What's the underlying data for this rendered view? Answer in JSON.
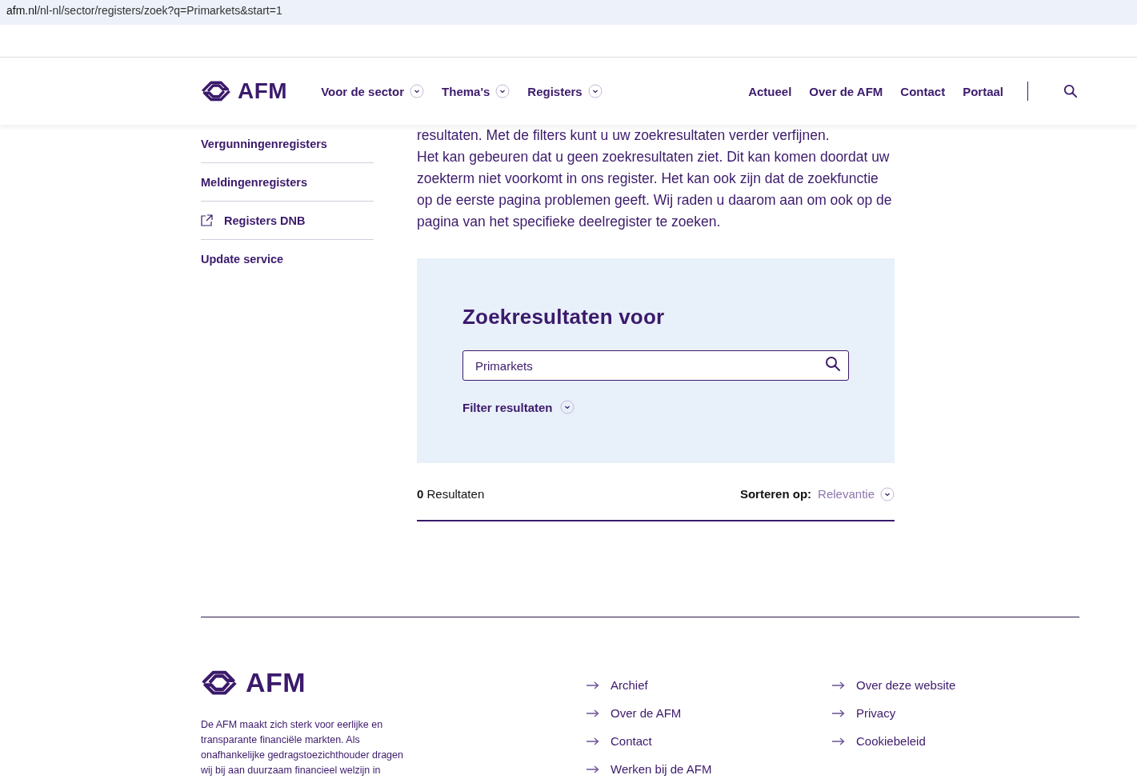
{
  "address_bar": {
    "domain": "afm.nl",
    "path": "/nl-nl/sector/registers/zoek?q=Primarkets&start=1"
  },
  "header": {
    "logo_text": "AFM",
    "nav_menus": [
      {
        "label": "Voor de sector",
        "expanded": false
      },
      {
        "label": "Thema's",
        "expanded": false
      },
      {
        "label": "Registers",
        "expanded": false
      }
    ],
    "nav_links": [
      "Actueel",
      "Over de AFM",
      "Contact",
      "Portaal"
    ]
  },
  "sidebar": {
    "items": [
      {
        "label": "Vergunningenregisters",
        "kind": "link"
      },
      {
        "label": "Meldingenregisters",
        "kind": "link"
      },
      {
        "label": "Registers DNB",
        "kind": "external"
      },
      {
        "label": "Update service",
        "kind": "link"
      }
    ]
  },
  "intro": {
    "paragraphs": [
      "resultaten. Met de filters kunt u uw zoekresultaten verder verfijnen.",
      "Het kan gebeuren dat u geen zoekresultaten ziet. Dit kan komen doordat uw zoekterm niet voorkomt in ons register. Het kan ook zijn dat de zoekfunctie op de eerste pagina problemen geeft. Wij raden u daarom aan om ook op de pagina van het specifieke deelregister te zoeken."
    ]
  },
  "search_panel": {
    "heading": "Zoekresultaten voor",
    "query": "Primarkets",
    "filter_label": "Filter resultaten",
    "filter_expanded": false
  },
  "results": {
    "summary": "**0** Resultaten",
    "sort_label": "Sorteren op:",
    "sort_value": "Relevantie",
    "sort_expanded": false
  },
  "footer": {
    "logo_text": "AFM",
    "description": "De AFM maakt zich sterk voor eerlijke en transparante financiële markten. Als onafhankelijke gedragstoezichthouder dragen wij bij aan duurzaam financieel welzijn in",
    "links_column_1": [
      "Archief",
      "Over de AFM",
      "Contact",
      "Werken bij de AFM"
    ],
    "links_column_2": [
      "Over deze website",
      "Privacy",
      "Cookiebeleid"
    ]
  }
}
